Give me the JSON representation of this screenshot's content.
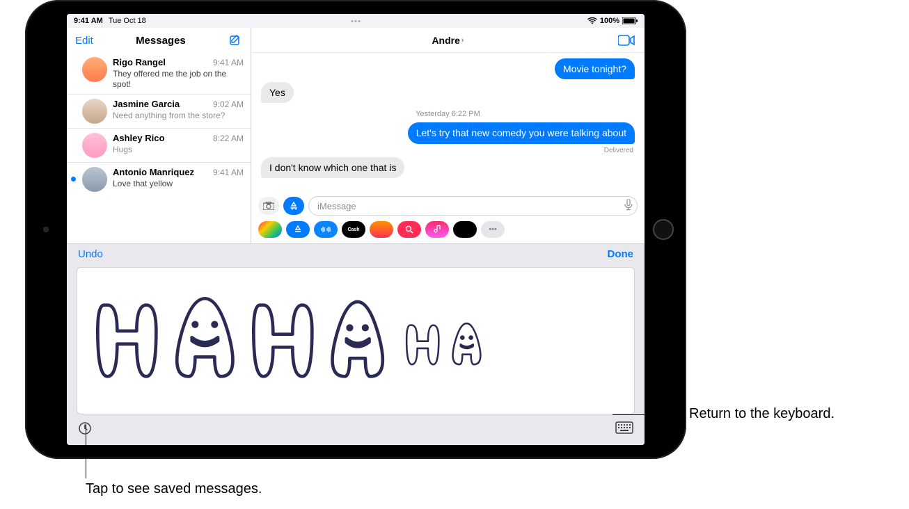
{
  "status": {
    "time": "9:41 AM",
    "date": "Tue Oct 18",
    "battery_pct": "100%"
  },
  "sidebar": {
    "edit_label": "Edit",
    "title": "Messages",
    "conversations": [
      {
        "name": "Rigo Rangel",
        "time": "9:41 AM",
        "preview": "They offered me the job on the spot!",
        "unread": false
      },
      {
        "name": "Jasmine Garcia",
        "time": "9:02 AM",
        "preview": "Need anything from the store?",
        "unread": false
      },
      {
        "name": "Ashley Rico",
        "time": "8:22 AM",
        "preview": "Hugs",
        "unread": false
      },
      {
        "name": "Antonio Manriquez",
        "time": "9:41 AM",
        "preview": "Love that yellow",
        "unread": true
      }
    ]
  },
  "chat": {
    "contact": "Andre",
    "messages": [
      {
        "dir": "sent",
        "text": "Movie tonight?"
      },
      {
        "dir": "recv",
        "text": "Yes"
      }
    ],
    "timestamp": "Yesterday 6:22 PM",
    "messages2": [
      {
        "dir": "sent",
        "text": "Let's try that new comedy you were talking about"
      }
    ],
    "delivered": "Delivered",
    "messages3": [
      {
        "dir": "recv",
        "text": "I don't know which one that is"
      }
    ],
    "input_placeholder": "iMessage"
  },
  "handwriting": {
    "undo_label": "Undo",
    "done_label": "Done"
  },
  "callouts": {
    "keyboard": "Return to the keyboard.",
    "saved": "Tap to see saved messages."
  },
  "icons": {
    "compose": "compose-icon",
    "facetime": "facetime-icon",
    "camera": "camera-icon",
    "appstore": "appstore-icon",
    "mic": "mic-icon",
    "clock": "clock-icon",
    "keyboard": "keyboard-icon",
    "wifi": "wifi-icon",
    "battery": "battery-icon"
  }
}
